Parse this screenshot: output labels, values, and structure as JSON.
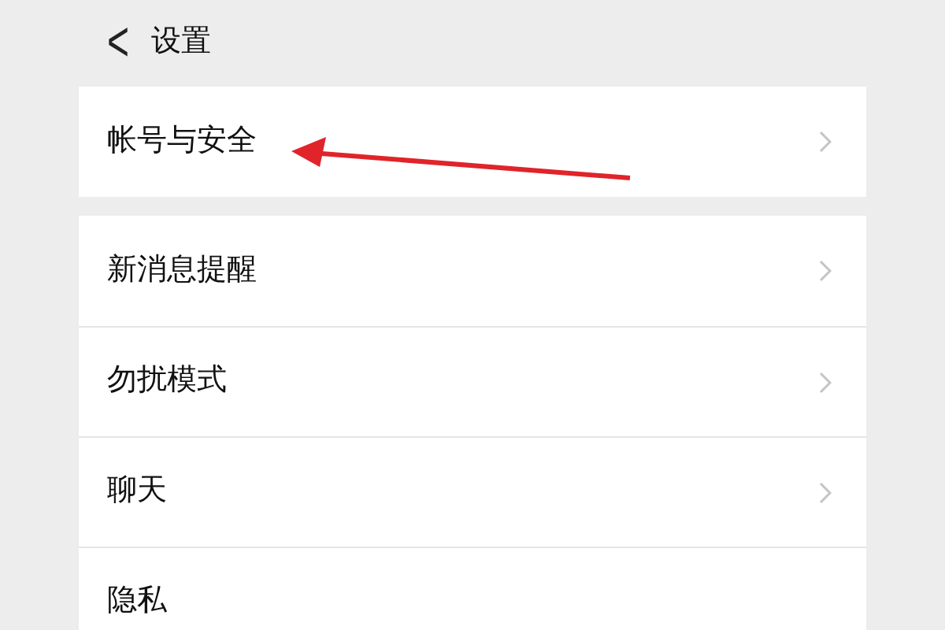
{
  "header": {
    "back_glyph": "<",
    "title": "设置"
  },
  "groups": [
    {
      "items": [
        {
          "label": "帐号与安全",
          "chevron": true
        }
      ]
    },
    {
      "items": [
        {
          "label": "新消息提醒",
          "chevron": true
        },
        {
          "label": "勿扰模式",
          "chevron": true
        },
        {
          "label": "聊天",
          "chevron": true
        },
        {
          "label": "隐私",
          "chevron": false
        }
      ]
    }
  ],
  "annotation": {
    "kind": "arrow",
    "color": "#e0242a"
  }
}
